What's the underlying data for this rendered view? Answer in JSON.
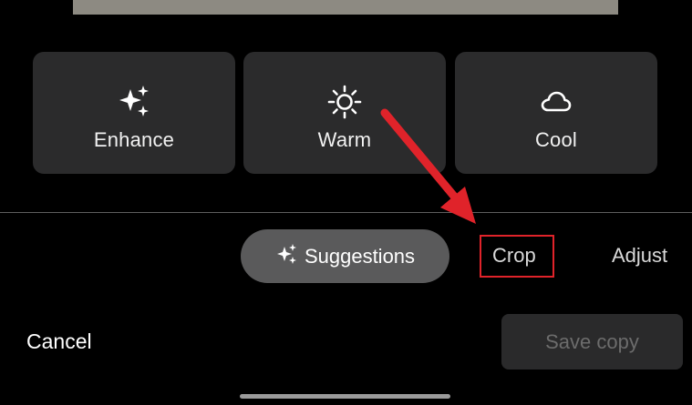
{
  "filters": [
    {
      "label": "Enhance",
      "icon": "sparkle-icon"
    },
    {
      "label": "Warm",
      "icon": "sun-icon"
    },
    {
      "label": "Cool",
      "icon": "cloud-icon"
    }
  ],
  "tabs": {
    "suggestions": {
      "label": "Suggestions",
      "icon": "sparkle-icon",
      "selected": true
    },
    "crop": {
      "label": "Crop",
      "highlighted": true
    },
    "adjust": {
      "label": "Adjust"
    }
  },
  "actions": {
    "cancel_label": "Cancel",
    "save_label": "Save copy",
    "save_enabled": false
  },
  "colors": {
    "background": "#000000",
    "card": "#2b2b2c",
    "pill": "#5a5a5b",
    "annotation": "#e0232a",
    "disabled_text": "#6c6c6c"
  }
}
